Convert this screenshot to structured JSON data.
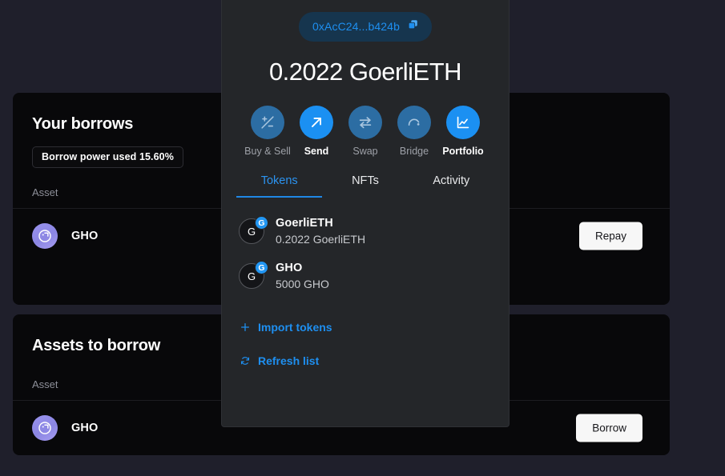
{
  "theme": {
    "page_bg": "#1f1f2b",
    "card_bg": "#08080a",
    "panel_bg": "#242629",
    "accent_blue": "#1e8ff0",
    "accent_blue_muted": "#2c6da3",
    "gho_purple": "#9a93ee",
    "button_bg": "#f7f7f7"
  },
  "background_page": {
    "your_borrows": {
      "title": "Your borrows",
      "borrow_power_badge": "Borrow power used 15.60%",
      "column_header_asset": "Asset",
      "rows": [
        {
          "symbol": "GHO",
          "icon": "gho-token-icon",
          "action_label": "Repay"
        }
      ]
    },
    "assets_to_borrow": {
      "title": "Assets to borrow",
      "column_header_asset": "Asset",
      "rows": [
        {
          "symbol": "GHO",
          "icon": "gho-token-icon",
          "action_label": "Borrow"
        }
      ]
    }
  },
  "wallet_panel": {
    "address": {
      "text": "0xAcC24...b424b",
      "copy_icon": "copy-icon"
    },
    "balance": "0.2022 GoerliETH",
    "actions": [
      {
        "label": "Buy & Sell",
        "icon": "plus-minus-icon",
        "active": false
      },
      {
        "label": "Send",
        "icon": "arrow-up-right-icon",
        "active": true
      },
      {
        "label": "Swap",
        "icon": "swap-arrows-icon",
        "active": false
      },
      {
        "label": "Bridge",
        "icon": "bridge-arc-icon",
        "active": false
      },
      {
        "label": "Portfolio",
        "icon": "chart-line-icon",
        "active": true
      }
    ],
    "tabs": [
      {
        "label": "Tokens",
        "active": true
      },
      {
        "label": "NFTs",
        "active": false
      },
      {
        "label": "Activity",
        "active": false
      }
    ],
    "tokens": [
      {
        "name": "GoerliETH",
        "balance": "0.2022 GoerliETH",
        "avatar_letter": "G",
        "network_badge_letter": "G"
      },
      {
        "name": "GHO",
        "balance": "5000 GHO",
        "avatar_letter": "G",
        "network_badge_letter": "G"
      }
    ],
    "links": {
      "import_tokens": "Import tokens",
      "import_icon": "plus-icon",
      "refresh_list": "Refresh list",
      "refresh_icon": "refresh-icon"
    }
  }
}
